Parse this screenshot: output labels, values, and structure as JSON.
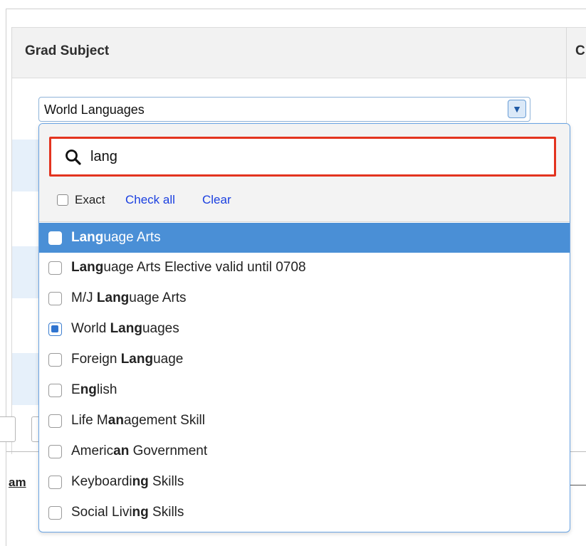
{
  "table": {
    "column_header": "Grad Subject",
    "next_column_header_partial": "C",
    "partial_link_text": "am"
  },
  "select": {
    "value": "World Languages",
    "arrow_icon": "triangle-down-icon"
  },
  "dropdown": {
    "search": {
      "value": "lang",
      "icon": "search-icon",
      "highlight_color": "#e3341f"
    },
    "exact_label": "Exact",
    "check_all_label": "Check all",
    "clear_label": "Clear",
    "options": [
      {
        "pre": "",
        "match": "Lang",
        "post": "uage Arts",
        "checked": false,
        "highlighted": true
      },
      {
        "pre": "",
        "match": "Lang",
        "post": "uage Arts Elective valid until 0708",
        "checked": false,
        "highlighted": false
      },
      {
        "pre": "M/J ",
        "match": "Lang",
        "post": "uage Arts",
        "checked": false,
        "highlighted": false
      },
      {
        "pre": "World ",
        "match": "Lang",
        "post": "uages",
        "checked": true,
        "highlighted": false
      },
      {
        "pre": "Foreign ",
        "match": "Lang",
        "post": "uage",
        "checked": false,
        "highlighted": false
      },
      {
        "pre": "E",
        "match": "ng",
        "post": "lish",
        "checked": false,
        "highlighted": false
      },
      {
        "pre": "Life M",
        "match": "an",
        "post": "agement Skill",
        "checked": false,
        "highlighted": false
      },
      {
        "pre": "Americ",
        "match": "an",
        "post": " Government",
        "checked": false,
        "highlighted": false
      },
      {
        "pre": "Keyboardi",
        "match": "ng",
        "post": " Skills",
        "checked": false,
        "highlighted": false
      },
      {
        "pre": "Social Livi",
        "match": "ng",
        "post": " Skills",
        "checked": false,
        "highlighted": false
      }
    ]
  },
  "colors": {
    "highlight_row": "#4a8fd6",
    "link": "#1a3fe0",
    "row_band": "#e6f0fa",
    "panel_border": "#6aa4e3"
  }
}
